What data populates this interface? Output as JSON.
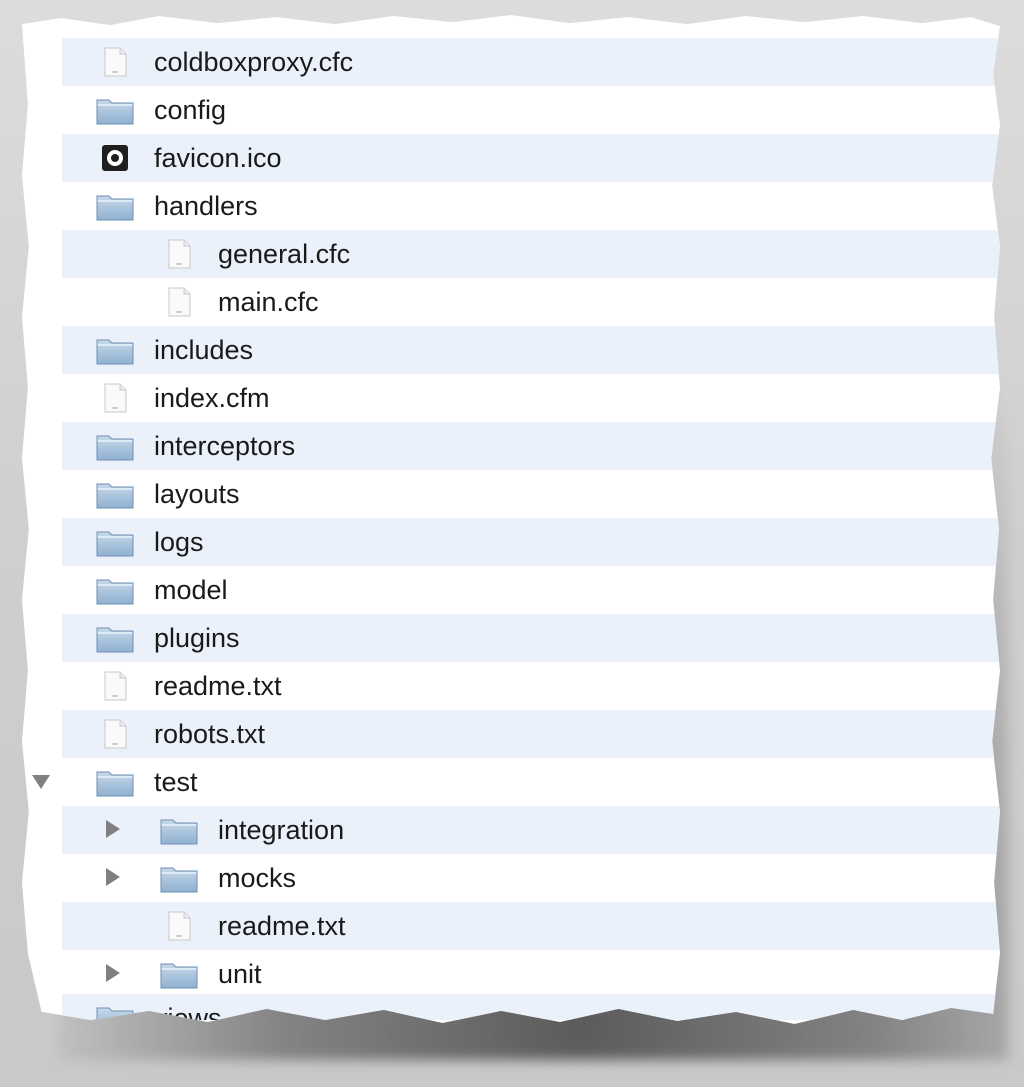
{
  "file_browser": {
    "items": [
      {
        "label": "coldboxproxy.cfc",
        "icon": "document-icon",
        "level": 0
      },
      {
        "label": "config",
        "icon": "folder-icon",
        "level": 0
      },
      {
        "label": "favicon.ico",
        "icon": "favicon-icon",
        "level": 0
      },
      {
        "label": "handlers",
        "icon": "folder-icon",
        "level": 0
      },
      {
        "label": "general.cfc",
        "icon": "document-icon",
        "level": 1
      },
      {
        "label": "main.cfc",
        "icon": "document-icon",
        "level": 1
      },
      {
        "label": "includes",
        "icon": "folder-icon",
        "level": 0
      },
      {
        "label": "index.cfm",
        "icon": "document-icon",
        "level": 0
      },
      {
        "label": "interceptors",
        "icon": "folder-icon",
        "level": 0
      },
      {
        "label": "layouts",
        "icon": "folder-icon",
        "level": 0
      },
      {
        "label": "logs",
        "icon": "folder-icon",
        "level": 0
      },
      {
        "label": "model",
        "icon": "folder-icon",
        "level": 0
      },
      {
        "label": "plugins",
        "icon": "folder-icon",
        "level": 0
      },
      {
        "label": "readme.txt",
        "icon": "document-icon",
        "level": 0
      },
      {
        "label": "robots.txt",
        "icon": "document-icon",
        "level": 0
      },
      {
        "label": "test",
        "icon": "folder-icon",
        "level": 0,
        "disclosure": "expanded"
      },
      {
        "label": "integration",
        "icon": "folder-icon",
        "level": 1,
        "disclosure": "collapsed"
      },
      {
        "label": "mocks",
        "icon": "folder-icon",
        "level": 1,
        "disclosure": "collapsed"
      },
      {
        "label": "readme.txt",
        "icon": "document-icon",
        "level": 1
      },
      {
        "label": "unit",
        "icon": "folder-icon",
        "level": 1,
        "disclosure": "collapsed"
      }
    ],
    "cut_off_item": {
      "label": "views",
      "icon": "folder-icon"
    }
  },
  "colors": {
    "row_alt": "#ebf1fb",
    "folder_top": "#c6d8ea",
    "folder_bottom": "#8fb1d1",
    "disclosure": "#808080",
    "text": "#1a1a1a"
  }
}
